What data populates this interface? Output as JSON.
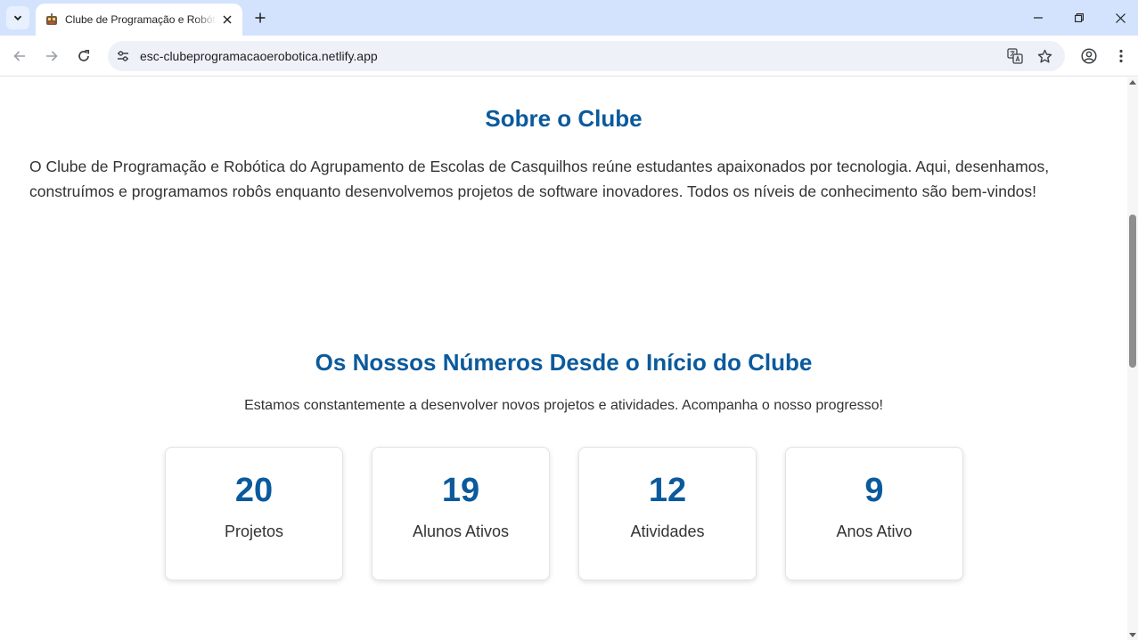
{
  "browser": {
    "tab": {
      "title": "Clube de Programação e Robótica"
    },
    "address_bar": {
      "url": "esc-clubeprogramacaoerobotica.netlify.app"
    },
    "icons": {
      "tab_list": "chevron-down-icon",
      "favicon": "robot-icon",
      "close": "close-icon",
      "new_tab": "plus-icon",
      "back": "arrow-left-icon",
      "forward": "arrow-right-icon",
      "reload": "reload-icon",
      "site_info": "tune-icon",
      "translate": "translate-icon",
      "bookmark": "star-icon",
      "profile": "profile-icon",
      "menu": "kebab-menu-icon"
    }
  },
  "about": {
    "title": "Sobre o Clube",
    "text": "O Clube de Programação e Robótica do Agrupamento de Escolas de Casquilhos reúne estudantes apaixonados por tecnologia. Aqui, desenhamos, construímos e programamos robôs enquanto desenvolvemos projetos de software inovadores. Todos os níveis de conhecimento são bem-vindos!"
  },
  "numbers": {
    "title": "Os Nossos Números Desde o Início do Clube",
    "subtitle": "Estamos constantemente a desenvolver novos projetos e atividades. Acompanha o nosso progresso!",
    "stats": [
      {
        "value": "20",
        "label": "Projetos"
      },
      {
        "value": "19",
        "label": "Alunos Ativos"
      },
      {
        "value": "12",
        "label": "Atividades"
      },
      {
        "value": "9",
        "label": "Anos Ativo"
      }
    ]
  },
  "colors": {
    "heading": "#0b5a9c",
    "tab_strip": "#d3e3fd",
    "text": "#333333"
  }
}
